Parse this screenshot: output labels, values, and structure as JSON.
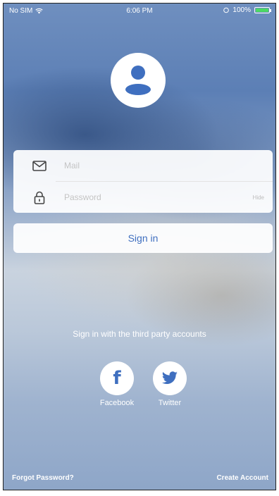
{
  "status_bar": {
    "carrier": "No SIM",
    "time": "6:06 PM",
    "battery_percent": "100%",
    "battery_level": 1.0,
    "battery_color": "#4cd964"
  },
  "login": {
    "mail_placeholder": "Mail",
    "password_placeholder": "Password",
    "show_password_label": "Hide",
    "sign_in_label": "Sign in"
  },
  "third_party": {
    "heading": "Sign in with the third party accounts",
    "accounts": [
      {
        "label": "Facebook",
        "icon": "facebook-icon"
      },
      {
        "label": "Twitter",
        "icon": "twitter-icon"
      }
    ]
  },
  "footer": {
    "forgot_password": "Forgot Password?",
    "create_account": "Create Account"
  },
  "colors": {
    "accent": "#3f6fbf"
  }
}
